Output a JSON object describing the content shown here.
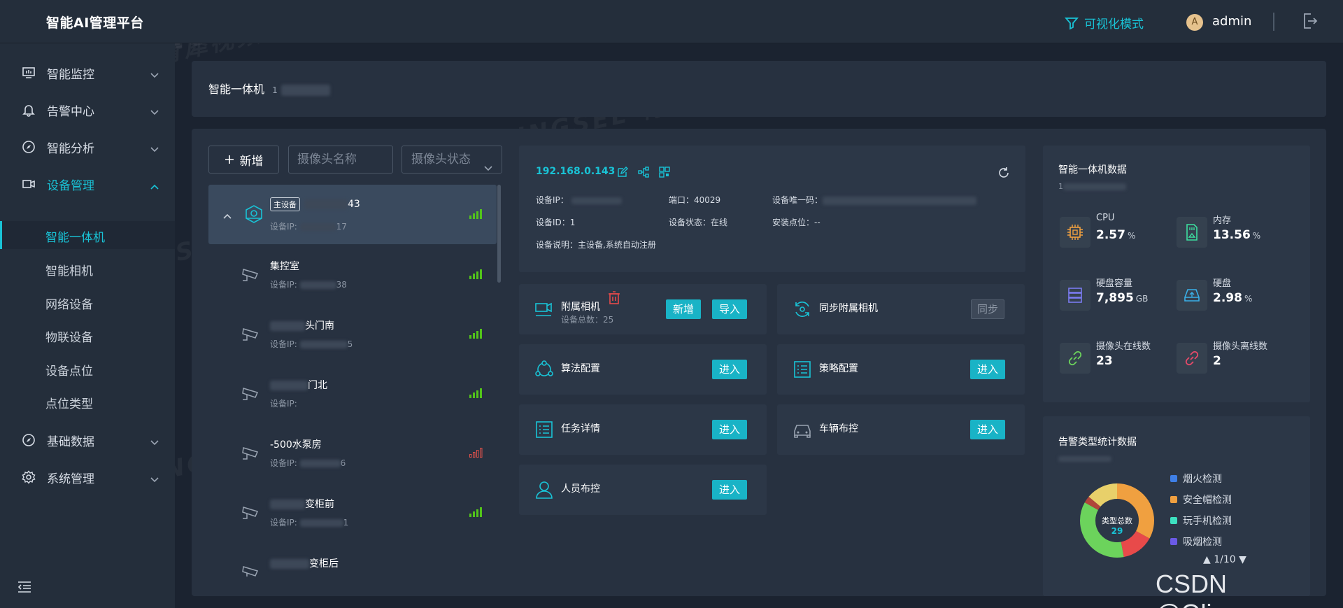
{
  "header": {
    "logo": "智能AI管理平台",
    "viz_mode": "可视化模式",
    "avatar_letter": "A",
    "username": "admin"
  },
  "sidebar": {
    "items": [
      {
        "label": "智能监控",
        "icon": "monitor-icon"
      },
      {
        "label": "告警中心",
        "icon": "bell-icon"
      },
      {
        "label": "智能分析",
        "icon": "compass-icon"
      },
      {
        "label": "设备管理",
        "icon": "camera-icon"
      },
      {
        "label": "基础数据",
        "icon": "compass-icon"
      },
      {
        "label": "系统管理",
        "icon": "gear-icon"
      }
    ],
    "sub_items": [
      "智能一体机",
      "智能相机",
      "网络设备",
      "物联设备",
      "设备点位",
      "点位类型"
    ]
  },
  "page": {
    "title": "智能一体机",
    "title_suffix": "1"
  },
  "toolbar": {
    "add_label": "新增",
    "name_placeholder": "摄像头名称",
    "status_placeholder": "摄像头状态"
  },
  "devices": [
    {
      "tag": "主设备",
      "name_suffix": "43",
      "ip_label": "设备IP:",
      "ip_suffix": "17",
      "signal": "good"
    },
    {
      "name": "集控室",
      "ip_label": "设备IP:",
      "ip_suffix": "38",
      "signal": "good"
    },
    {
      "name": "头门南",
      "ip_label": "设备IP:",
      "ip_suffix": "5",
      "signal": "good"
    },
    {
      "name": "门北",
      "ip_label": "设备IP:",
      "ip_suffix": "",
      "signal": "good"
    },
    {
      "name": "-500水泵房",
      "ip_label": "设备IP:",
      "ip_suffix": "6",
      "signal": "bad"
    },
    {
      "name": "变柜前",
      "ip_label": "设备IP:",
      "ip_suffix": "1",
      "signal": "good"
    },
    {
      "name": "变柜后",
      "ip_label": "",
      "ip_suffix": "",
      "signal": "none"
    }
  ],
  "device_info": {
    "ip": "192.168.0.143",
    "ip_label": "设备IP：",
    "port": "端口：40029",
    "uid_label": "设备唯一码：",
    "device_id": "设备ID：1",
    "status": "设备状态：在线",
    "install": "安装点位：--",
    "desc": "设备说明：主设备,系统自动注册"
  },
  "tiles": {
    "cameras": {
      "name": "附属相机",
      "sub": "设备总数：25",
      "add": "新增",
      "import": "导入"
    },
    "sync": {
      "name": "同步附属相机",
      "btn": "同步"
    },
    "algo": {
      "name": "算法配置",
      "btn": "进入"
    },
    "policy": {
      "name": "策略配置",
      "btn": "进入"
    },
    "task": {
      "name": "任务详情",
      "btn": "进入"
    },
    "vehicle": {
      "name": "车辆布控",
      "btn": "进入"
    },
    "person": {
      "name": "人员布控",
      "btn": "进入"
    }
  },
  "stats": {
    "title": "智能一体机数据",
    "subtitle": "1",
    "cpu": {
      "label": "CPU",
      "value": "2.57",
      "unit": "%"
    },
    "mem": {
      "label": "内存",
      "value": "13.56",
      "unit": "%"
    },
    "disk_cap": {
      "label": "硬盘容量",
      "value": "7,895",
      "unit": "GB"
    },
    "disk": {
      "label": "硬盘",
      "value": "2.98",
      "unit": "%"
    },
    "online": {
      "label": "摄像头在线数",
      "value": "23"
    },
    "offline": {
      "label": "摄像头离线数",
      "value": "2"
    }
  },
  "alarm": {
    "title": "告警类型统计数据",
    "center_label": "类型总数",
    "center_value": "29",
    "legend": [
      {
        "name": "烟火检测",
        "color": "#3f7fe6"
      },
      {
        "name": "安全帽检测",
        "color": "#f0a040"
      },
      {
        "name": "玩手机检测",
        "color": "#3de0c0"
      },
      {
        "name": "吸烟检测",
        "color": "#6b5ae6"
      }
    ],
    "pager": "▲ 1/10 ▼",
    "donut": [
      {
        "value": 33,
        "color": "#f0a040"
      },
      {
        "value": 14,
        "color": "#e84a4a"
      },
      {
        "value": 36,
        "color": "#6cd35c"
      },
      {
        "value": 3,
        "color": "#b0453a"
      },
      {
        "value": 14,
        "color": "#e8d06a"
      }
    ]
  },
  "watermark": "TSINGSEE 青犀视频",
  "csdn": "CSDN @Oliverro"
}
